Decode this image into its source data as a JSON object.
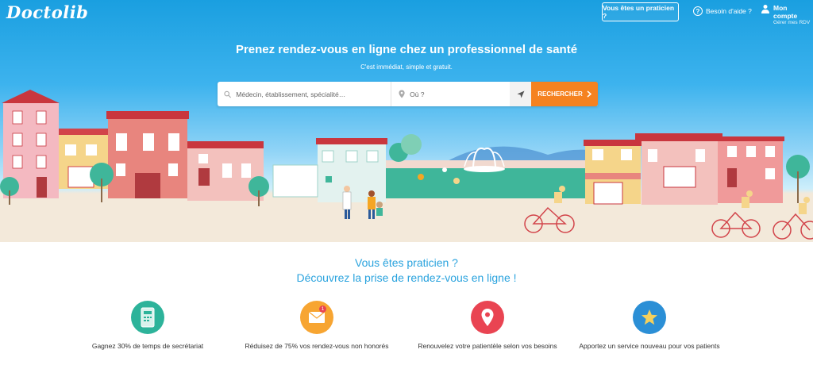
{
  "brand": {
    "logo": "Doctolib"
  },
  "header": {
    "pro_button": "Vous êtes un praticien ?",
    "help_label": "Besoin d'aide ?",
    "account_title": "Mon compte",
    "account_sub": "Gérer mes RDV"
  },
  "hero": {
    "title": "Prenez rendez-vous en ligne chez un professionnel de santé",
    "subtitle": "C'est immédiat, simple et gratuit.",
    "search": {
      "what_placeholder": "Médecin, établissement, spécialité…",
      "where_placeholder": "Où ?",
      "button": "RECHERCHER"
    }
  },
  "pro_section": {
    "line1": "Vous êtes praticien ?",
    "line2": "Découvrez la prise de rendez-vous en ligne !",
    "features": [
      {
        "label": "Gagnez 30% de temps de secrétariat",
        "color": "#2db39a",
        "icon": "phone-icon"
      },
      {
        "label": "Réduisez de 75% vos rendez-vous non honorés",
        "color": "#f7a532",
        "icon": "envelope-icon",
        "badge": "1"
      },
      {
        "label": "Renouvelez votre patientèle selon vos besoins",
        "color": "#e94452",
        "icon": "map-pin-icon"
      },
      {
        "label": "Apportez un service nouveau pour vos patients",
        "color": "#2b8fd6",
        "icon": "star-icon"
      }
    ]
  },
  "colors": {
    "accent": "#2aa3de",
    "cta": "#f58220"
  }
}
